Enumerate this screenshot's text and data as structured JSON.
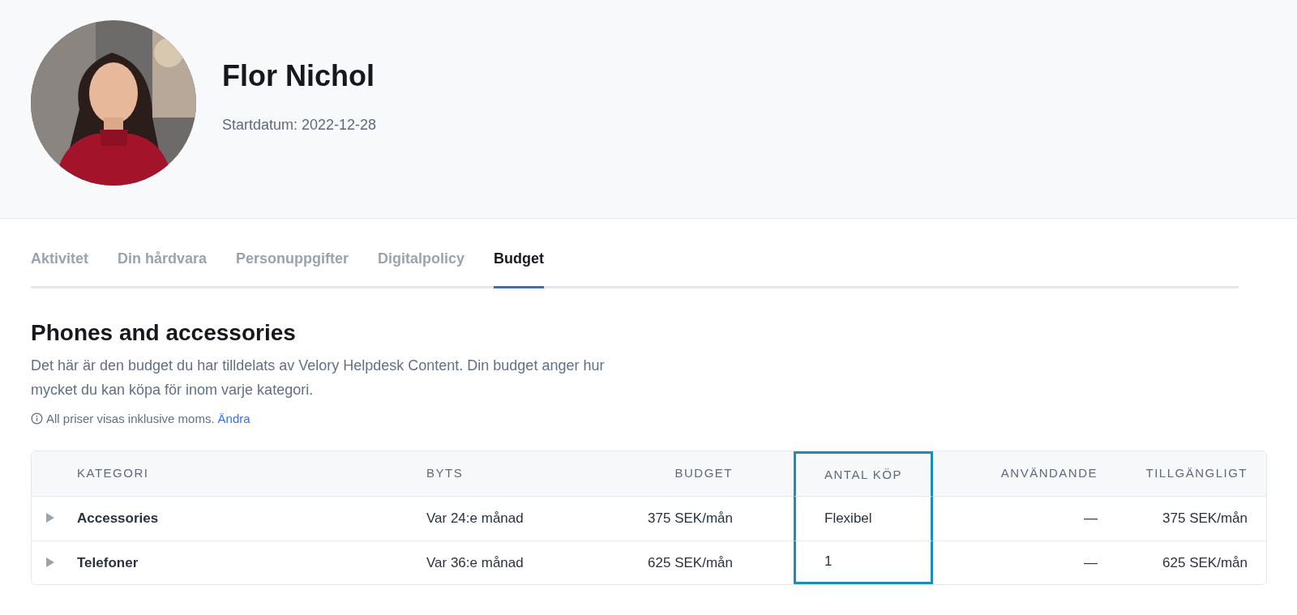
{
  "profile": {
    "name": "Flor Nichol",
    "start_date": "Startdatum: 2022-12-28"
  },
  "tabs": [
    {
      "label": "Aktivitet",
      "selected": false
    },
    {
      "label": "Din hårdvara",
      "selected": false
    },
    {
      "label": "Personuppgifter",
      "selected": false
    },
    {
      "label": "Digitalpolicy",
      "selected": false
    },
    {
      "label": "Budget",
      "selected": true
    }
  ],
  "section": {
    "title": "Phones and accessories",
    "description": "Det här är den budget du har tilldelats av Velory Helpdesk Content. Din budget anger hur mycket du kan köpa för inom varje kategori.",
    "note": "All priser visas inklusive moms.",
    "note_link": "Ändra"
  },
  "table": {
    "columns": [
      {
        "label": "KATEGORI",
        "highlighted": false
      },
      {
        "label": "BYTS",
        "highlighted": false
      },
      {
        "label": "BUDGET",
        "highlighted": false
      },
      {
        "label": "ANTAL KÖP",
        "highlighted": true
      },
      {
        "label": "ANVÄNDANDE",
        "highlighted": false
      },
      {
        "label": "TILLGÄNGLIGT",
        "highlighted": false
      }
    ],
    "rows": [
      {
        "expanded": false,
        "cells": [
          "Accessories",
          "Var 24:e månad",
          "375 SEK/mån",
          "Flexibel",
          "—",
          "375 SEK/mån"
        ]
      },
      {
        "expanded": false,
        "cells": [
          "Telefoner",
          "Var 36:e månad",
          "625 SEK/mån",
          "1",
          "—",
          "625 SEK/mån"
        ]
      }
    ]
  }
}
